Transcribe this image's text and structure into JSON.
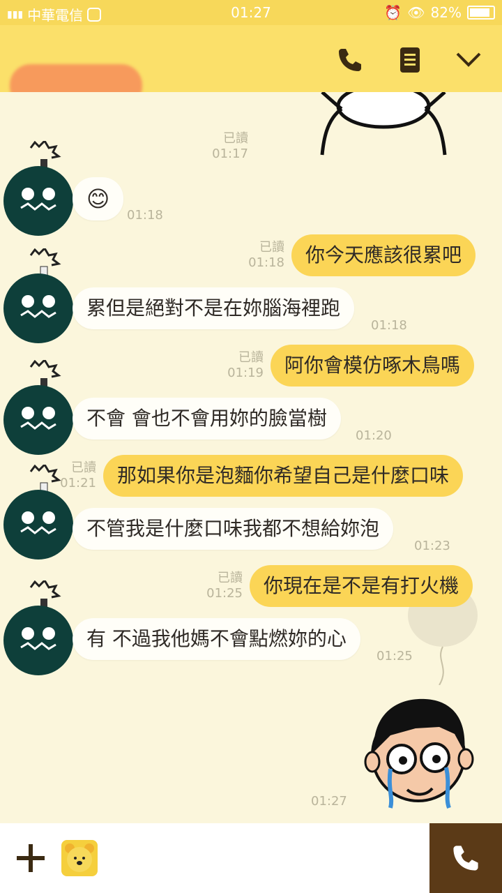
{
  "status_bar": {
    "carrier": "中華電信",
    "time": "01:27",
    "battery": "82%"
  },
  "header": {
    "icons": [
      "phone-icon",
      "menu-icon",
      "chevron-down-icon"
    ]
  },
  "messages": [
    {
      "side": "in",
      "text": "😊",
      "time": "01:18"
    },
    {
      "side": "out",
      "text": "你今天應該很累吧",
      "read": "已讀",
      "time": "01:18"
    },
    {
      "side": "in",
      "text": "累但是絕對不是在妳腦海裡跑",
      "time": "01:18"
    },
    {
      "side": "out",
      "text": "阿你會模仿啄木鳥嗎",
      "read": "已讀",
      "time": "01:19"
    },
    {
      "side": "in",
      "text": "不會 會也不會用妳的臉當樹",
      "time": "01:20"
    },
    {
      "side": "out",
      "text": "那如果你是泡麵你希望自己是什麼口味",
      "read": "已讀",
      "time": "01:21"
    },
    {
      "side": "in",
      "text": "不管我是什麼口味我都不想給妳泡",
      "time": "01:23"
    },
    {
      "side": "out",
      "text": "你現在是不是有打火機",
      "read": "已讀",
      "time": "01:25"
    },
    {
      "side": "in",
      "text": "有 不過我他媽不會點燃妳的心",
      "time": "01:25"
    }
  ],
  "top_read": {
    "read": "已讀",
    "time": "01:17"
  },
  "last_time": "01:27",
  "colors": {
    "status_bar": "#f7d85a",
    "header": "#fbe06a",
    "chat_bg": "#fbf6dc",
    "outgoing_bubble": "#fbd556",
    "incoming_bubble": "#fffef8",
    "call_button": "#5b3a17"
  },
  "input_bar": {
    "icons": [
      "plus-icon",
      "sticker-bear-icon",
      "call-icon"
    ]
  }
}
